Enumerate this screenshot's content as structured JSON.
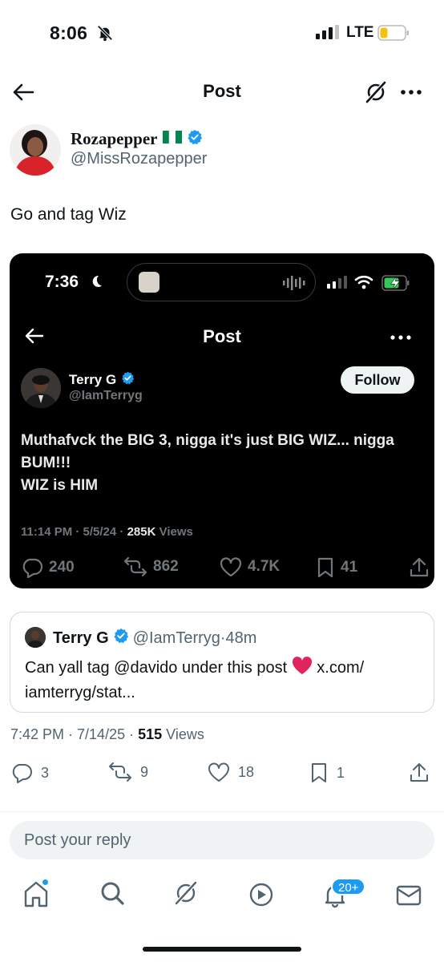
{
  "status_bar": {
    "time": "8:06",
    "network": "LTE"
  },
  "header": {
    "title": "Post"
  },
  "author": {
    "name": "Rozapepper",
    "flag": "🇳🇬",
    "handle": "@MissRozapepper"
  },
  "post": {
    "text": "Go and tag Wiz"
  },
  "embedded_screenshot": {
    "status_time": "7:36",
    "title": "Post",
    "author_name": "Terry G",
    "author_handle": "@IamTerryg",
    "follow_label": "Follow",
    "body_lines": [
      "Muthafvck the BIG 3, nigga it's just BIG WIZ... nigga",
      "BUM!!!",
      "WIZ is HIM"
    ],
    "meta_prefix": "11:14 PM · 5/5/24 · ",
    "views_count": "285K",
    "views_label": " Views",
    "replies": "240",
    "reposts": "862",
    "likes": "4.7K",
    "bookmarks": "41"
  },
  "quote": {
    "name": "Terry G",
    "handle": "@IamTerryg",
    "time": "·48m",
    "text_line1_a": "Can yall tag @davido under this post ",
    "text_line1_b": " x.com/",
    "text_line2": "iamterryg/stat..."
  },
  "meta": {
    "prefix": "7:42 PM · 7/14/25 · ",
    "views_count": "515",
    "views_label": " Views"
  },
  "actions": {
    "replies": "3",
    "reposts": "9",
    "likes": "18",
    "bookmarks": "1"
  },
  "reply": {
    "placeholder": "Post your reply"
  },
  "tabbar": {
    "badge": "20+"
  },
  "colors": {
    "accent": "#1d9bf0",
    "verified": "#1d9bf0",
    "muted": "#536471",
    "heart": "#e0245e"
  }
}
